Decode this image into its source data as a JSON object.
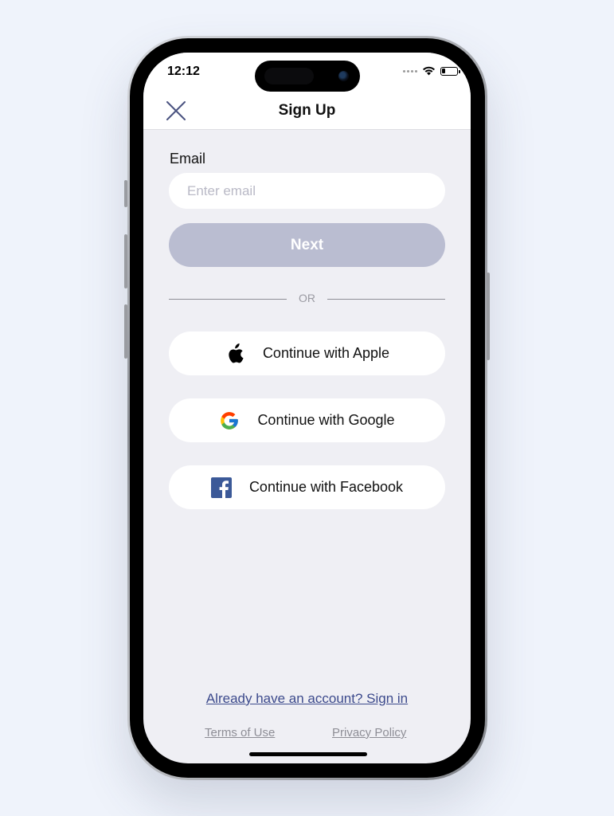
{
  "status_bar": {
    "time": "12:12",
    "icons": [
      "signal-dots-icon",
      "wifi-icon",
      "battery-icon"
    ]
  },
  "nav": {
    "title": "Sign Up",
    "close_icon": "close-icon"
  },
  "form": {
    "email_label": "Email",
    "email_value": "",
    "email_placeholder": "Enter email",
    "next_label": "Next",
    "next_enabled": false
  },
  "divider": {
    "text": "OR"
  },
  "social": [
    {
      "label": "Continue with Apple",
      "icon": "apple-logo-icon"
    },
    {
      "label": "Continue with Google",
      "icon": "google-logo-icon"
    },
    {
      "label": "Continue with Facebook",
      "icon": "facebook-logo-icon"
    }
  ],
  "footer": {
    "signin_link": "Already have an account? Sign in",
    "terms": "Terms of Use",
    "privacy": "Privacy Policy"
  },
  "colors": {
    "background": "#eff3fb",
    "screen": "#efeff4",
    "next_disabled": "#babdd1",
    "link": "#3c4a8c",
    "facebook": "#3b5998"
  }
}
